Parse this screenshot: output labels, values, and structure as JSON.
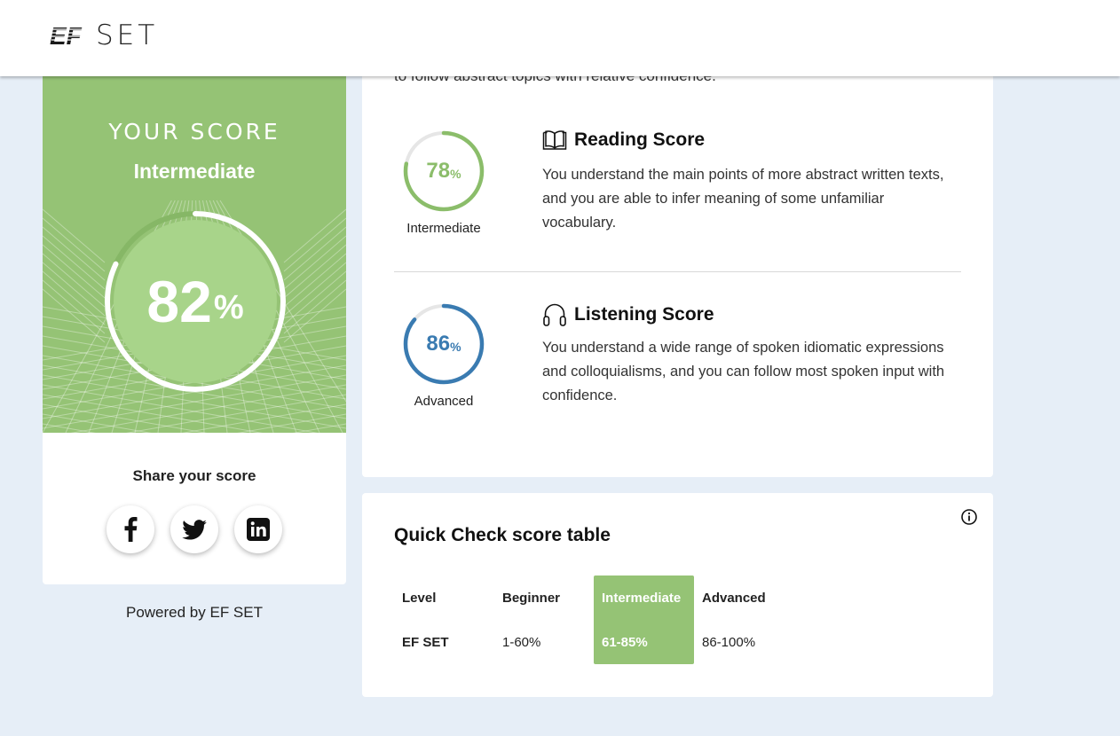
{
  "header": {
    "logo_mark": "EF",
    "logo_text": "SET"
  },
  "score_card": {
    "heading": "YOUR SCORE",
    "level": "Intermediate",
    "score": "82",
    "percent_sign": "%",
    "score_fraction": 0.82,
    "share_title": "Share your score",
    "share_buttons": [
      {
        "icon": "facebook-icon"
      },
      {
        "icon": "twitter-icon"
      },
      {
        "icon": "linkedin-icon"
      }
    ]
  },
  "powered_by": "Powered by EF SET",
  "skills": {
    "cut_text": "to follow abstract topics with relative confidence.",
    "items": [
      {
        "score": "78",
        "percent_sign": "%",
        "fraction": 0.78,
        "level": "Intermediate",
        "title": "Reading Score",
        "icon": "book-icon",
        "color": "#8bbd6a",
        "description": "You understand the main points of more abstract written texts, and you are able to infer meaning of some unfamiliar vocabulary."
      },
      {
        "score": "86",
        "percent_sign": "%",
        "fraction": 0.86,
        "level": "Advanced",
        "title": "Listening Score",
        "icon": "headphones-icon",
        "color": "#3a7bb1",
        "description": "You understand a wide range of spoken idiomatic expressions and colloquialisms, and you can follow most spoken input with confidence."
      }
    ]
  },
  "score_table": {
    "title": "Quick Check score table",
    "headers": [
      "Level",
      "Beginner",
      "Intermediate",
      "Advanced"
    ],
    "row": [
      "EF SET",
      "1-60%",
      "61-85%",
      "86-100%"
    ],
    "highlight_color": "#95c375"
  }
}
